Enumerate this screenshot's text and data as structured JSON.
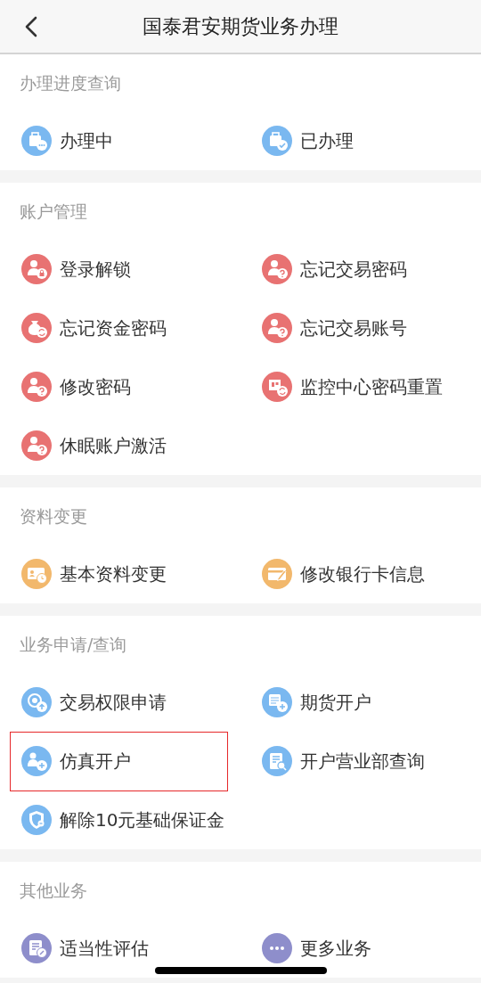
{
  "header": {
    "title": "国泰君安期货业务办理"
  },
  "sections": [
    {
      "title": "办理进度查询",
      "color": "#7ab8f0",
      "items": [
        {
          "label": "办理中",
          "highlighted": false
        },
        {
          "label": "已办理",
          "highlighted": false
        }
      ]
    },
    {
      "title": "账户管理",
      "color": "#e87272",
      "items": [
        {
          "label": "登录解锁",
          "highlighted": false
        },
        {
          "label": "忘记交易密码",
          "highlighted": false
        },
        {
          "label": "忘记资金密码",
          "highlighted": false
        },
        {
          "label": "忘记交易账号",
          "highlighted": false
        },
        {
          "label": "修改密码",
          "highlighted": false
        },
        {
          "label": "监控中心密码重置",
          "highlighted": false
        },
        {
          "label": "休眠账户激活",
          "highlighted": false
        }
      ]
    },
    {
      "title": "资料变更",
      "color": "#f2b86c",
      "items": [
        {
          "label": "基本资料变更",
          "highlighted": false
        },
        {
          "label": "修改银行卡信息",
          "highlighted": false
        }
      ]
    },
    {
      "title": "业务申请/查询",
      "color": "#7ab8f0",
      "items": [
        {
          "label": "交易权限申请",
          "highlighted": false
        },
        {
          "label": "期货开户",
          "highlighted": false
        },
        {
          "label": "仿真开户",
          "highlighted": true
        },
        {
          "label": "开户营业部查询",
          "highlighted": false
        },
        {
          "label": "解除10元基础保证金",
          "highlighted": false
        }
      ]
    },
    {
      "title": "其他业务",
      "color": "#8e8ecb",
      "items": [
        {
          "label": "适当性评估",
          "highlighted": false
        },
        {
          "label": "更多业务",
          "highlighted": false
        }
      ]
    }
  ]
}
